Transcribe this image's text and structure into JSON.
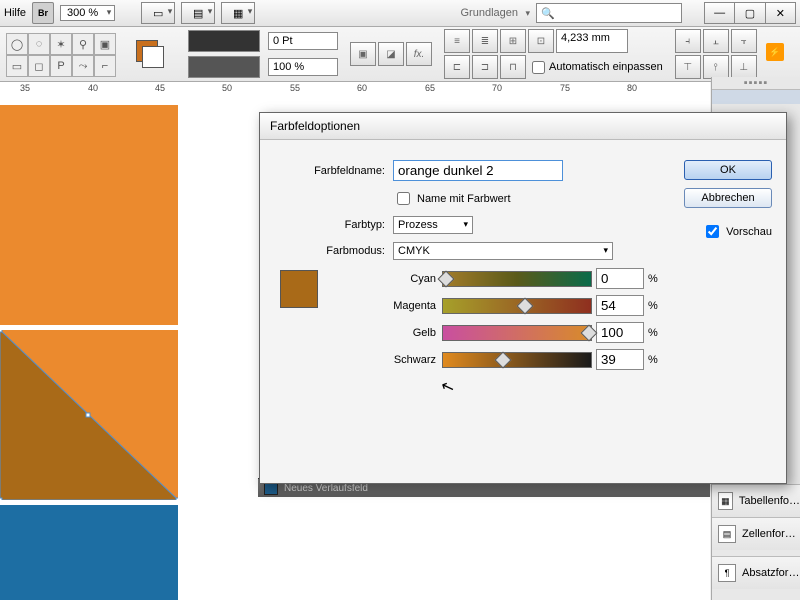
{
  "menubar": {
    "help": "Hilfe",
    "br": "Br",
    "zoom": "300 %",
    "workspace": "Grundlagen"
  },
  "toolbar": {
    "stroke_pt": "0 Pt",
    "opacity": "100 %",
    "size": "4,233 mm",
    "auto_fit": "Automatisch einpassen"
  },
  "ruler": {
    "marks": [
      "35",
      "40",
      "45",
      "50",
      "55",
      "60",
      "65",
      "70",
      "75",
      "80"
    ]
  },
  "dialog": {
    "title": "Farbfeldoptionen",
    "name_lbl": "Farbfeldname:",
    "name_val": "orange dunkel 2",
    "name_chk": "Name mit Farbwert",
    "type_lbl": "Farbtyp:",
    "type_val": "Prozess",
    "mode_lbl": "Farbmodus:",
    "mode_val": "CMYK",
    "sliders": {
      "c": {
        "lbl": "Cyan",
        "val": "0",
        "pct": 0,
        "grad": "linear-gradient(90deg,#a37c2a,#5a5a1a,#0a6b4a)"
      },
      "m": {
        "lbl": "Magenta",
        "val": "54",
        "pct": 54,
        "grad": "linear-gradient(90deg,#a6a02a,#8f2f1f)"
      },
      "y": {
        "lbl": "Gelb",
        "val": "100",
        "pct": 100,
        "grad": "linear-gradient(90deg,#c94fa0,#d88b2a)"
      },
      "k": {
        "lbl": "Schwarz",
        "val": "39",
        "pct": 39,
        "grad": "linear-gradient(90deg,#e08a1e,#1a1a1a)"
      }
    },
    "ok": "OK",
    "cancel": "Abbrechen",
    "preview": "Vorschau"
  },
  "sidepanel": {
    "item1": "Tabellenfo…",
    "item2": "Zellenfor…",
    "item3": "Absatzfor…"
  },
  "context": {
    "label": "Neues Verlaufsfeld"
  },
  "colors": {
    "orange": "#eb8a2e",
    "brown": "#a96a18",
    "blue": "#1d6ea3"
  }
}
